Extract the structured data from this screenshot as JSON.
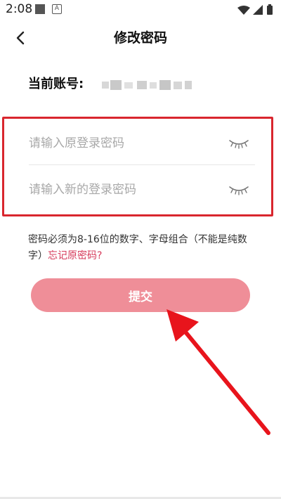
{
  "status_bar": {
    "time": "2:08",
    "notification_badge": "A"
  },
  "nav": {
    "title": "修改密码"
  },
  "account": {
    "label": "当前账号:"
  },
  "form": {
    "original_password": {
      "value": "",
      "placeholder": "请输入原登录密码"
    },
    "new_password": {
      "value": "",
      "placeholder": "请输入新的登录密码"
    }
  },
  "hint": {
    "text": "密码必须为8-16位的数字、字母组合（不能是纯数字）",
    "forgot_link": "忘记原密码?"
  },
  "submit_button": {
    "label": "提交"
  },
  "colors": {
    "accent": "#ef8e98",
    "link": "#d63a5a",
    "highlight_box": "#d9262e",
    "annotation_arrow": "#e8141c"
  },
  "icons": [
    "back-icon",
    "eye-closed-icon",
    "wifi-icon",
    "battery-icon"
  ]
}
